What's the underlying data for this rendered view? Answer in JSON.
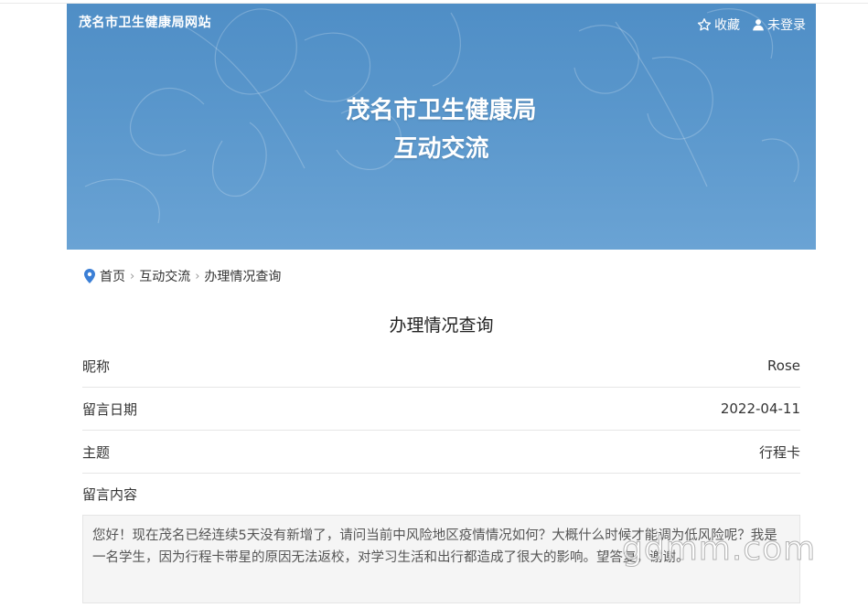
{
  "header": {
    "site_name": "茂名市卫生健康局网站",
    "favorite_label": "收藏",
    "login_label": "未登录",
    "title_line1": "茂名市卫生健康局",
    "title_line2": "互动交流"
  },
  "breadcrumb": {
    "items": [
      "首页",
      "互动交流",
      "办理情况查询"
    ]
  },
  "page_heading": "办理情况查询",
  "fields": [
    {
      "label": "昵称",
      "value": "Rose"
    },
    {
      "label": "留言日期",
      "value": "2022-04-11"
    },
    {
      "label": "主题",
      "value": "行程卡"
    }
  ],
  "message": {
    "label": "留言内容",
    "content": "您好！现在茂名已经连续5天没有新增了，请问当前中风险地区疫情情况如何？大概什么时候才能调为低风险呢？我是一名学生，因为行程卡带星的原因无法返校，对学习生活和出行都造成了很大的影响。望答复，谢谢。"
  },
  "watermark": "gdmm.com",
  "colors": {
    "banner": "#5a97cc",
    "pin": "#3b7fd6"
  }
}
